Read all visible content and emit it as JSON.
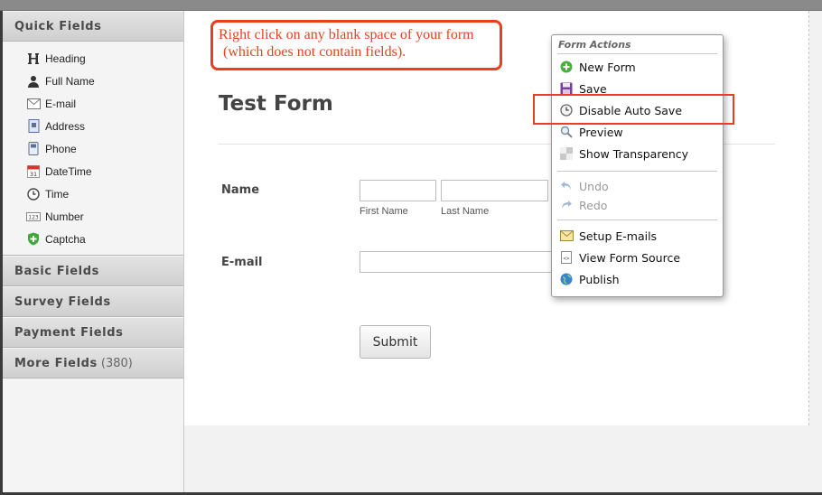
{
  "sidebar": {
    "quick_fields": {
      "header": "Quick Fields",
      "items": [
        {
          "label": "Heading",
          "icon": "heading-icon"
        },
        {
          "label": "Full Name",
          "icon": "person-icon"
        },
        {
          "label": "E-mail",
          "icon": "envelope-icon"
        },
        {
          "label": "Address",
          "icon": "address-book-icon"
        },
        {
          "label": "Phone",
          "icon": "phone-icon"
        },
        {
          "label": "DateTime",
          "icon": "calendar-icon"
        },
        {
          "label": "Time",
          "icon": "clock-icon"
        },
        {
          "label": "Number",
          "icon": "number-icon"
        },
        {
          "label": "Captcha",
          "icon": "shield-plus-icon"
        }
      ]
    },
    "basic_fields": "Basic Fields",
    "survey_fields": "Survey Fields",
    "payment_fields": "Payment Fields",
    "more_fields": "More Fields",
    "more_fields_count": "(380)"
  },
  "callout": {
    "line1": "Right click on any blank space of your form",
    "line2": "(which does not contain fields)."
  },
  "form": {
    "title": "Test Form",
    "name_label": "Name",
    "first_name_sublabel": "First Name",
    "last_name_sublabel": "Last Name",
    "email_label": "E-mail",
    "submit_label": "Submit"
  },
  "context_menu": {
    "title": "Form Actions",
    "items": [
      {
        "label": "New Form",
        "icon": "plus-circle-icon",
        "enabled": true
      },
      {
        "label": "Save",
        "icon": "floppy-disk-icon",
        "enabled": true
      },
      {
        "label": "Disable Auto Save",
        "icon": "clock-icon",
        "enabled": true
      },
      {
        "label": "Preview",
        "icon": "magnifier-icon",
        "enabled": true
      },
      {
        "label": "Show Transparency",
        "icon": "transparency-icon",
        "enabled": true
      },
      {
        "label": "Undo",
        "icon": "undo-arrow-icon",
        "enabled": false
      },
      {
        "label": "Redo",
        "icon": "redo-arrow-icon",
        "enabled": false
      },
      {
        "label": "Setup E-mails",
        "icon": "envelope-icon",
        "enabled": true
      },
      {
        "label": "View Form Source",
        "icon": "source-code-icon",
        "enabled": true
      },
      {
        "label": "Publish",
        "icon": "globe-icon",
        "enabled": true
      }
    ]
  },
  "colors": {
    "annotation": "#e8401f",
    "sidebar_bg": "#f4f4f4",
    "canvas_bg": "#ffffff"
  }
}
